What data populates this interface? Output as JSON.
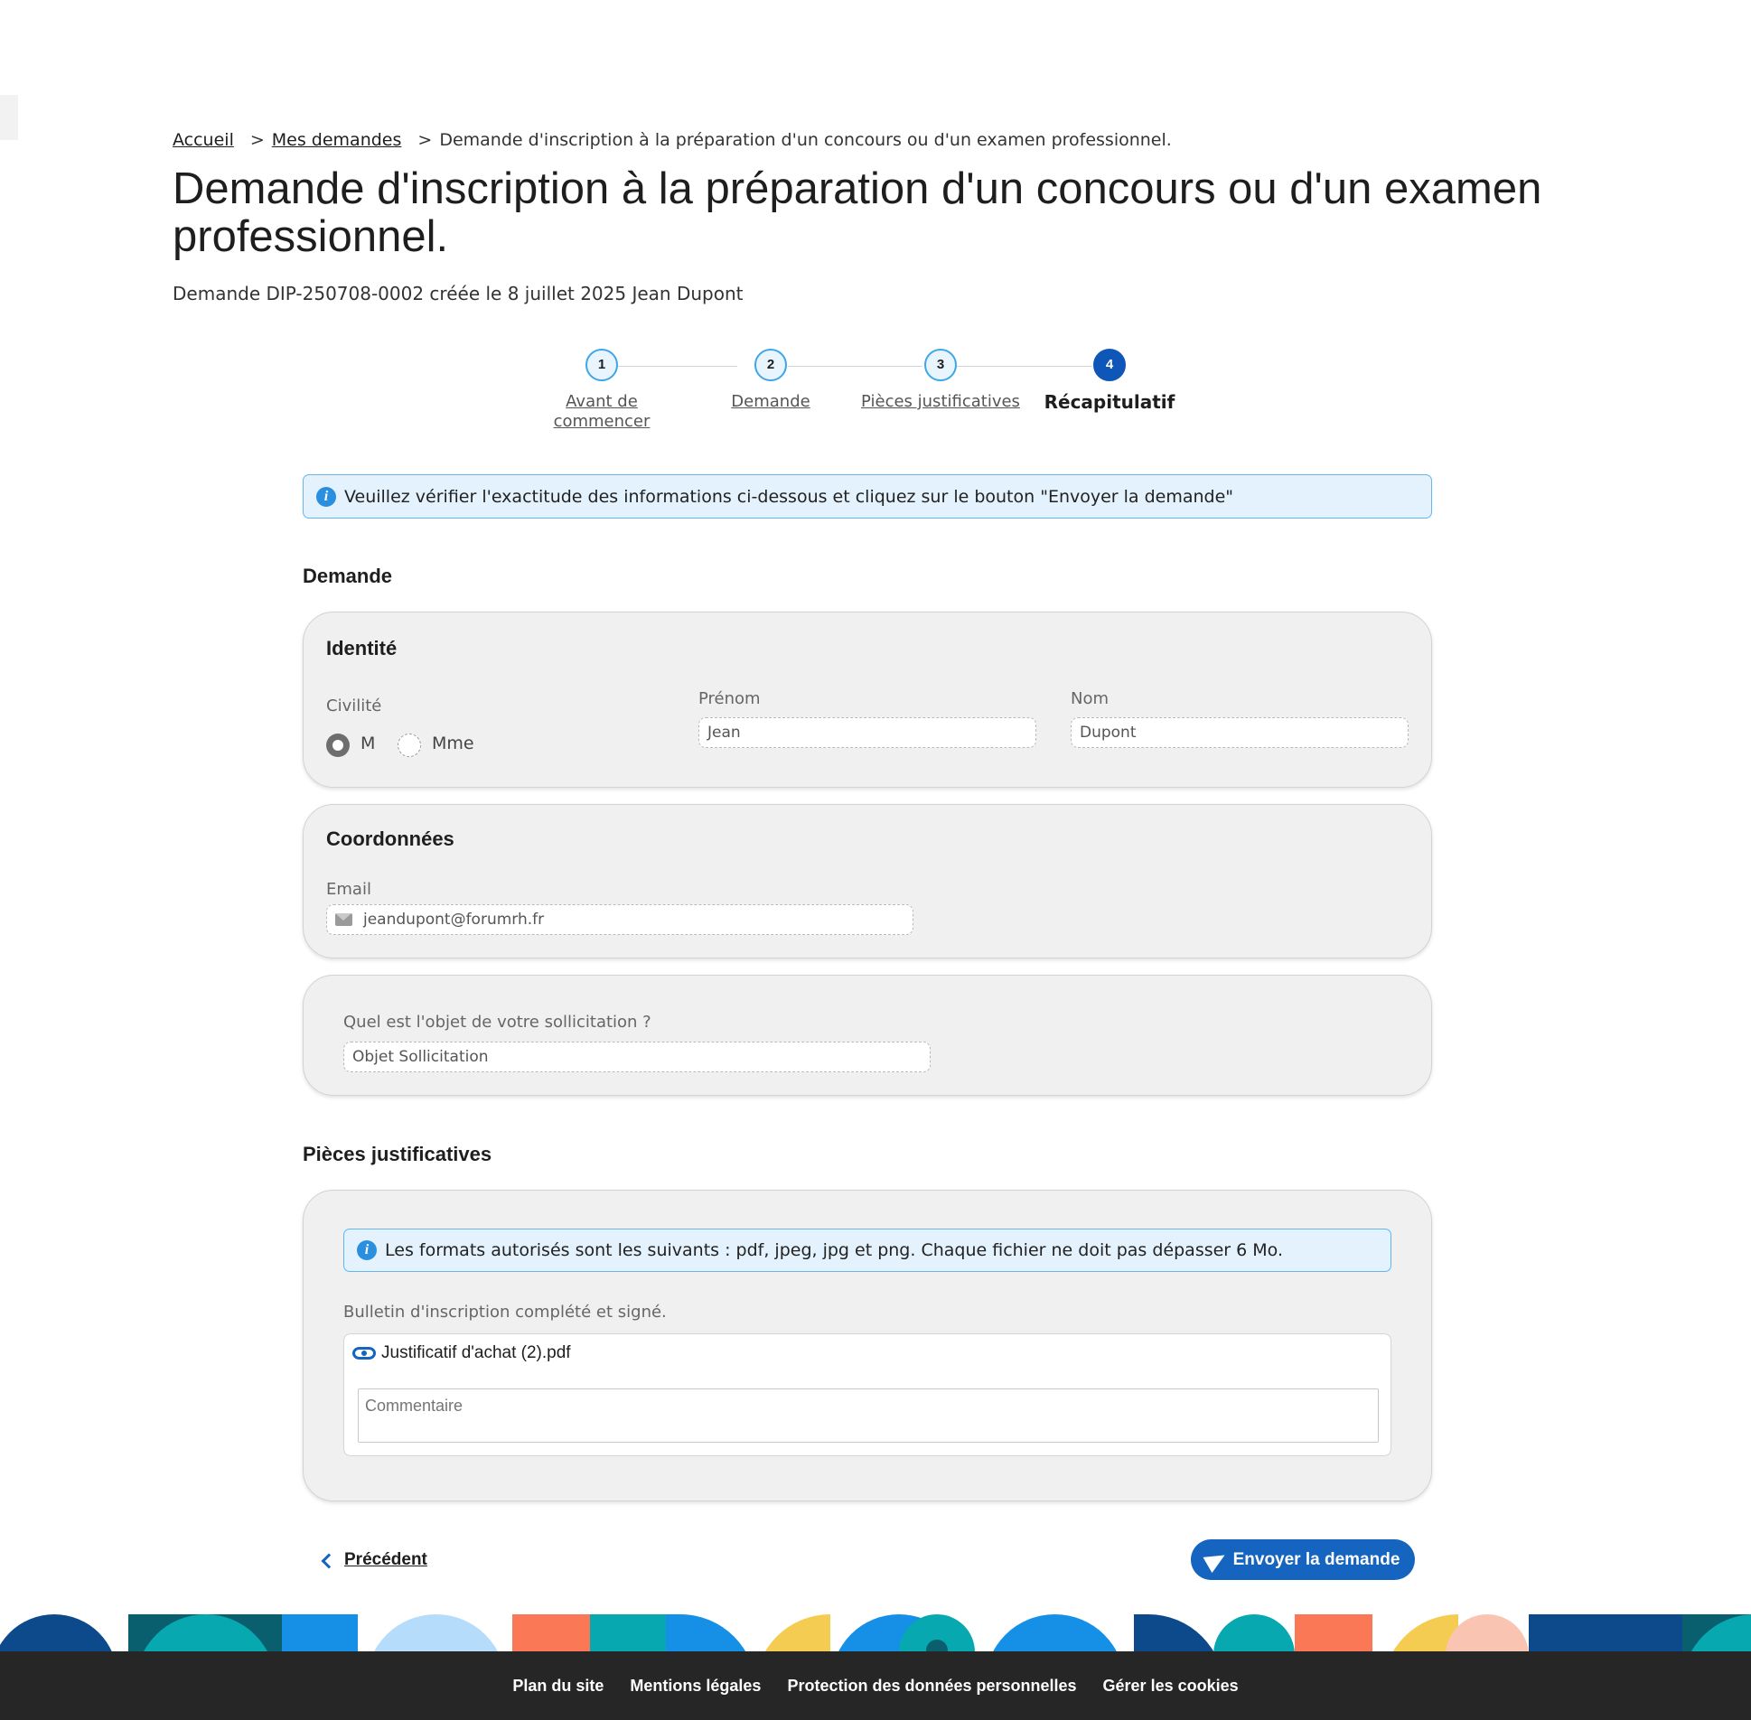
{
  "breadcrumb": {
    "home": "Accueil",
    "separator": ">",
    "requests": "Mes demandes",
    "current": "Demande d'inscription à la préparation d'un concours ou d'un examen professionnel."
  },
  "page": {
    "title": "Demande d'inscription à la préparation d'un concours ou d'un examen professionnel.",
    "subline": "Demande DIP-250708-0002 créée le 8 juillet 2025 Jean Dupont"
  },
  "stepper": {
    "steps": [
      {
        "number": "1",
        "label": "Avant de commencer"
      },
      {
        "number": "2",
        "label": "Demande"
      },
      {
        "number": "3",
        "label": "Pièces justificatives"
      },
      {
        "number": "4",
        "label": "Récapitulatif"
      }
    ],
    "current_step": 4
  },
  "info_banner": {
    "icon": "info-icon",
    "text": "Veuillez vérifier l'exactitude des informations ci-dessous et cliquez sur le bouton \"Envoyer la demande\""
  },
  "demande": {
    "section_title": "Demande",
    "identity": {
      "title": "Identité",
      "civility_label": "Civilité",
      "options": [
        "M",
        "Mme"
      ],
      "selected": "M",
      "firstname_label": "Prénom",
      "firstname_value": "Jean",
      "lastname_label": "Nom",
      "lastname_value": "Dupont"
    },
    "contact": {
      "title": "Coordonnées",
      "email_label": "Email",
      "email_icon": "envelope-icon",
      "email_value": "jeandupont@forumrh.fr"
    },
    "subject": {
      "question": "Quel est l'objet de votre sollicitation ?",
      "placeholder": "Objet Sollicitation"
    }
  },
  "pieces": {
    "section_title": "Pièces justificatives",
    "formats_info": "Les formats autorisés sont les suivants : pdf, jpeg, jpg et png. Chaque fichier ne doit pas dépasser 6 Mo.",
    "document_label": "Bulletin d'inscription complété et signé.",
    "file_icon": "eye-icon",
    "file_name": "Justificatif d'achat (2).pdf",
    "comment_placeholder": "Commentaire"
  },
  "actions": {
    "previous": "Précédent",
    "send": "Envoyer la demande"
  },
  "footer": {
    "links": [
      "Plan du site",
      "Mentions légales",
      "Protection des données personnelles",
      "Gérer les cookies"
    ]
  },
  "colors": {
    "primary": "#1565c0",
    "step_active": "#0e57b8",
    "info_bg": "#e3f2fd",
    "info_border": "#64b6f2",
    "card_bg": "#f0f0f0",
    "footer_bg": "#262626"
  }
}
